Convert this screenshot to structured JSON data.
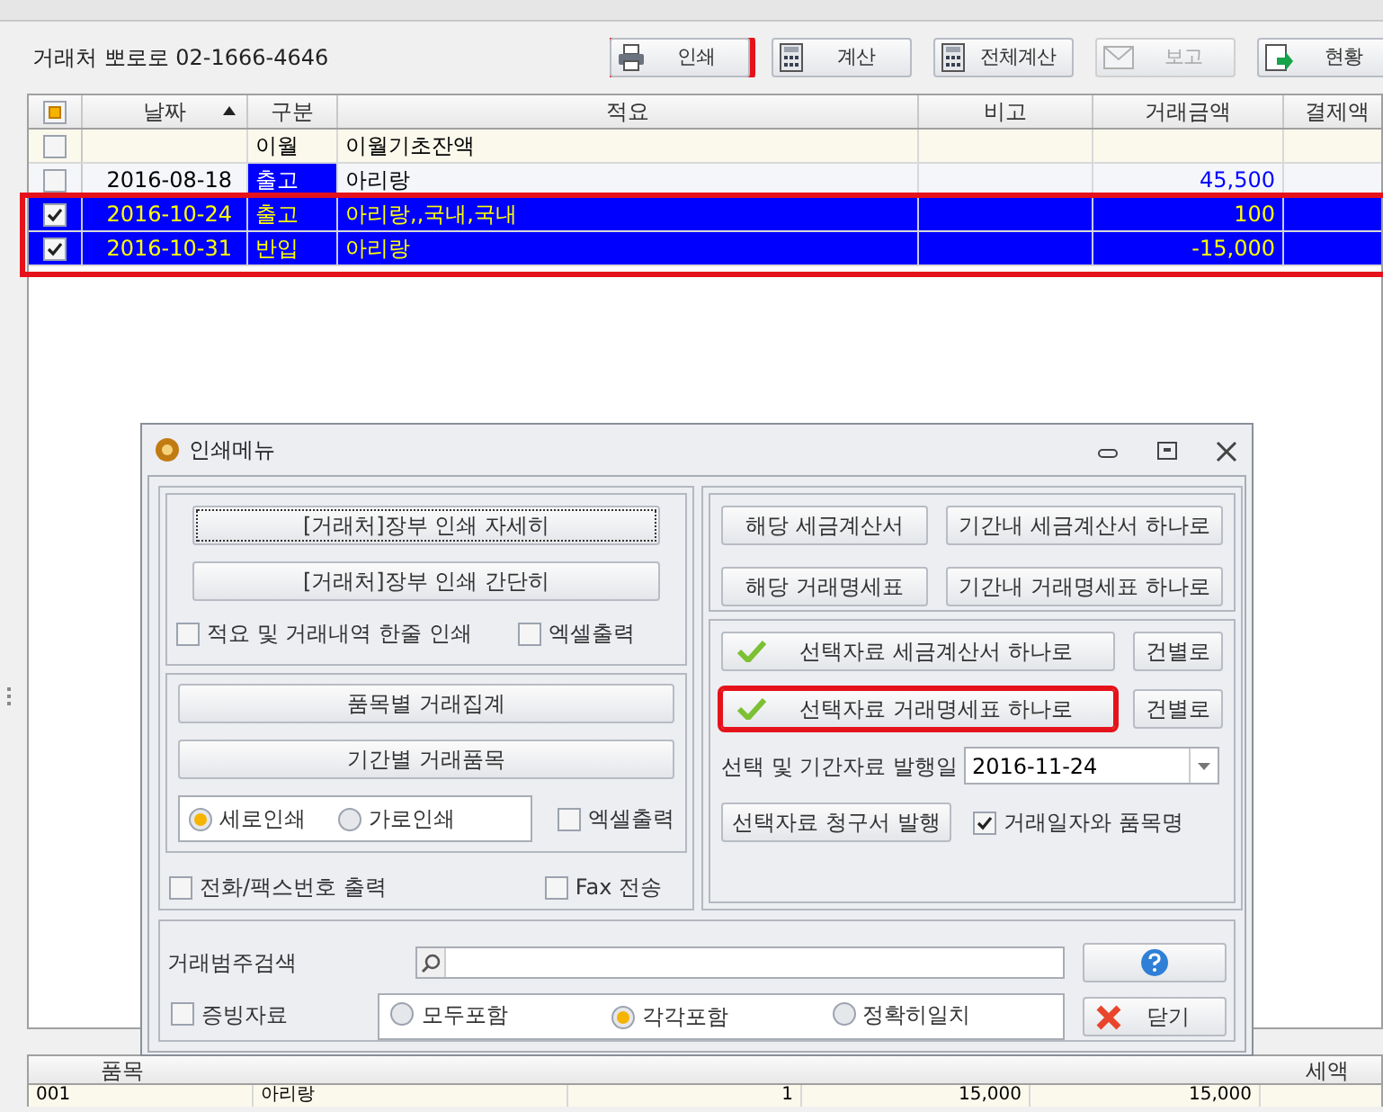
{
  "header": {
    "company": "거래처 뽀로로 02-1666-4646"
  },
  "toolbar": [
    {
      "label": "인쇄",
      "disabled": false,
      "highlighted": true
    },
    {
      "label": "계산",
      "disabled": false,
      "highlighted": false
    },
    {
      "label": "전체계산",
      "disabled": false,
      "highlighted": false
    },
    {
      "label": "보고",
      "disabled": true,
      "highlighted": false
    },
    {
      "label": "현황",
      "disabled": false,
      "highlighted": false
    }
  ],
  "ledger": {
    "all_indeterminate": true,
    "columns": [
      {
        "label": "날짜",
        "sorted": true
      },
      {
        "label": "구분",
        "sorted": false
      },
      {
        "label": "적요",
        "sorted": false
      },
      {
        "label": "비고",
        "sorted": false
      },
      {
        "label": "거래금액",
        "sorted": false
      },
      {
        "label": "결제액",
        "sorted": false
      }
    ],
    "rows": [
      {
        "checked": false,
        "selected": false,
        "date": "",
        "category": "이월",
        "category_focused": false,
        "description": "이월기초잔액",
        "amount": ""
      },
      {
        "checked": false,
        "selected": false,
        "date": "2016-08-18",
        "category": "출고",
        "category_focused": true,
        "description": "아리랑",
        "amount": "45,500"
      },
      {
        "checked": true,
        "selected": true,
        "date": "2016-10-24",
        "category": "출고",
        "category_focused": false,
        "description": "아리랑,,국내,국내",
        "amount": "100"
      },
      {
        "checked": true,
        "selected": true,
        "date": "2016-10-31",
        "category": "반입",
        "category_focused": false,
        "description": "아리랑",
        "amount": "-15,000"
      }
    ]
  },
  "print_dialog": {
    "title": "인쇄메뉴",
    "ledger_buttons": [
      {
        "label": "[거래처]장부 인쇄 자세히",
        "focused": true
      },
      {
        "label": "[거래처]장부 인쇄 간단히",
        "focused": false
      }
    ],
    "ledger_options": [
      {
        "label": "적요 및 거래내역 한줄 인쇄",
        "checked": false
      },
      {
        "label": "엑셀출력",
        "checked": false
      }
    ],
    "item_buttons": [
      {
        "label": "품목별 거래집계"
      },
      {
        "label": "기간별 거래품목"
      }
    ],
    "orientation": [
      {
        "label": "세로인쇄",
        "selected": true
      },
      {
        "label": "가로인쇄",
        "selected": false
      }
    ],
    "item_excel": {
      "label": "엑셀출력",
      "checked": false
    },
    "extra_options": [
      {
        "label": "전화/팩스번호 출력",
        "checked": false
      },
      {
        "label": "Fax 전송",
        "checked": false
      }
    ],
    "document_buttons": [
      "해당 세금계산서",
      "기간내 세금계산서 하나로",
      "해당 거래명세표",
      "기간내 거래명세표 하나로"
    ],
    "selection_rows": [
      {
        "label": "선택자료 세금계산서 하나로",
        "highlighted": false,
        "side": "건별로"
      },
      {
        "label": "선택자료 거래명세표 하나로",
        "highlighted": true,
        "side": "건별로"
      }
    ],
    "issue_date": {
      "label": "선택 및 기간자료 발행일",
      "value": "2016-11-24"
    },
    "invoice_button": "선택자료 청구서 발행",
    "item_option": {
      "label": "거래일자와 품목명",
      "checked": true
    },
    "search": {
      "label": "거래범주검색"
    },
    "evidence": {
      "label": "증빙자료",
      "checked": false
    },
    "match_modes": [
      {
        "label": "모두포함",
        "selected": false
      },
      {
        "label": "각각포함",
        "selected": true
      },
      {
        "label": "정확히일치",
        "selected": false
      }
    ],
    "close_button": "닫기"
  },
  "items_table": {
    "columns": [
      "품목",
      "세액"
    ],
    "row": [
      "001",
      "아리랑",
      "1",
      "15,000",
      "15,000"
    ]
  }
}
